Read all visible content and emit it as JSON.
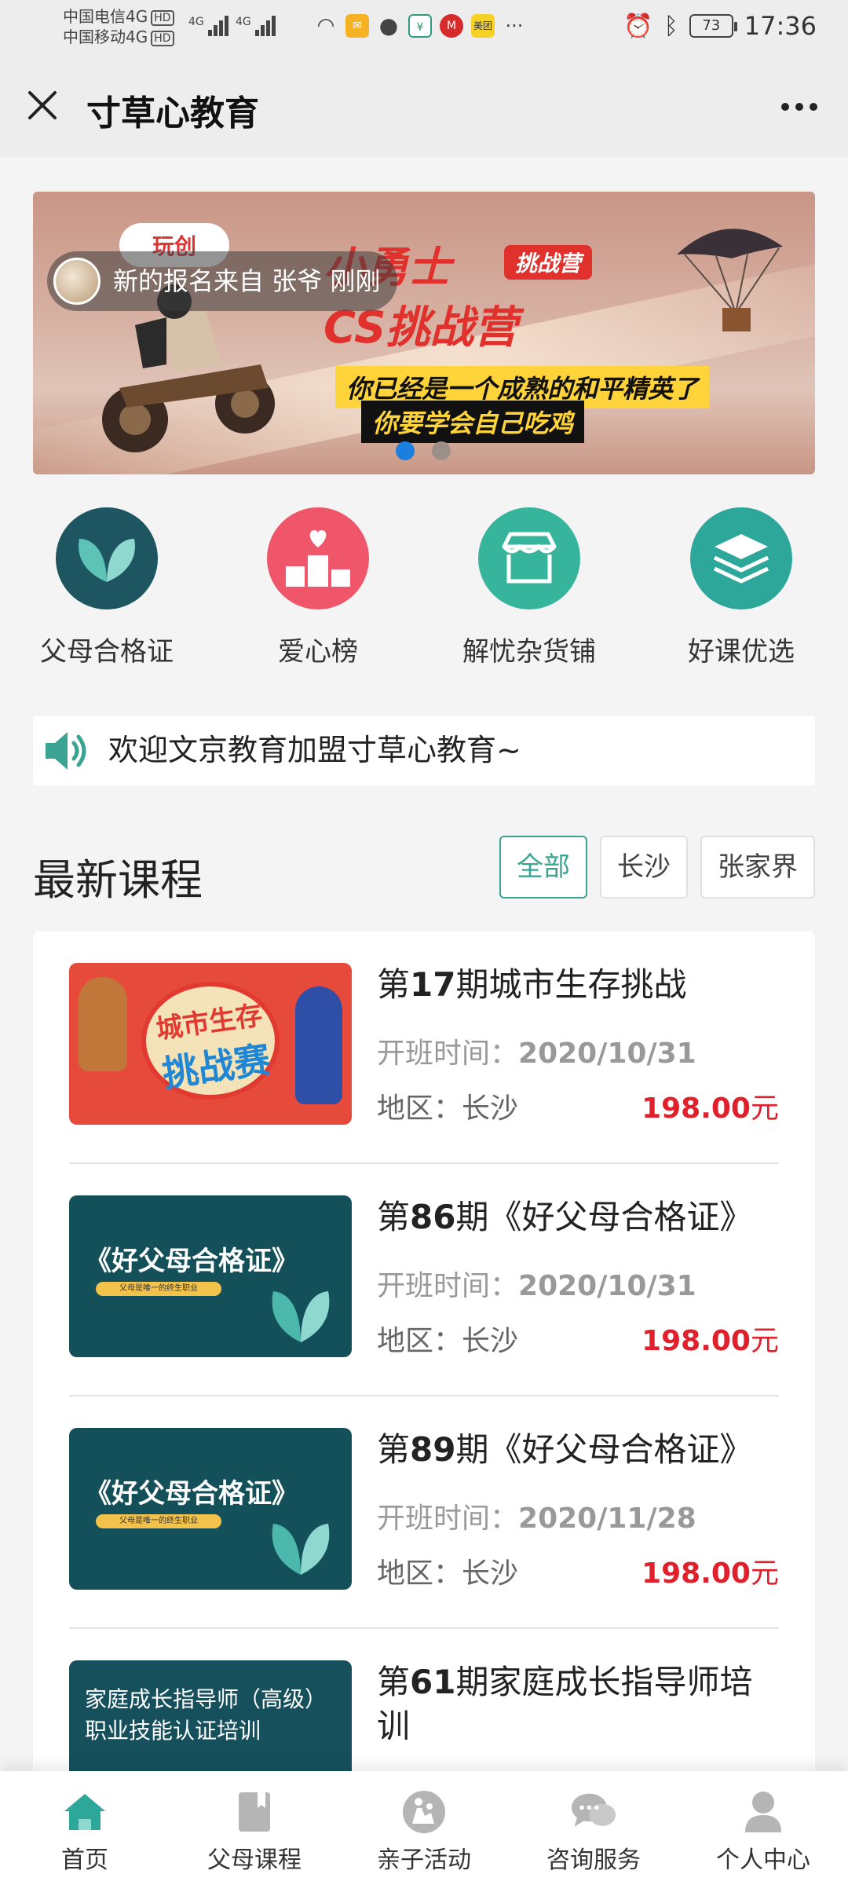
{
  "status_bar": {
    "carrier1": "中国电信4G",
    "carrier2": "中国移动4G",
    "hd": "HD",
    "net1": "4G",
    "net2": "4G",
    "app_badge": "美团",
    "more": "···",
    "battery": "73",
    "time": "17:36"
  },
  "header": {
    "title": "寸草心教育"
  },
  "banner": {
    "logo": "玩创",
    "headline1": "小勇士",
    "tag": "挑战营",
    "headline2": "CS挑战营",
    "line1": "你已经是一个成熟的和平精英了",
    "line2": "你要学会自己吃鸡",
    "notice": "新的报名来自 张爷 刚刚",
    "active_slide": 0,
    "slide_count": 2
  },
  "quick_nav": [
    {
      "label": "父母合格证",
      "icon": "heart-leaf-icon",
      "color": "#1d5560"
    },
    {
      "label": "爱心榜",
      "icon": "podium-heart-icon",
      "color": "#f0566a"
    },
    {
      "label": "解忧杂货铺",
      "icon": "shop-icon",
      "color": "#36b59c"
    },
    {
      "label": "好课优选",
      "icon": "layers-icon",
      "color": "#2ea79b"
    }
  ],
  "announcement": {
    "text": "欢迎文京教育加盟寸草心教育~"
  },
  "courses_section": {
    "title": "最新课程",
    "filters": [
      "全部",
      "长沙",
      "张家界"
    ],
    "active_filter": "全部"
  },
  "courses": [
    {
      "title_pre": "第",
      "issue": "17",
      "title_post": "期城市生存挑战",
      "time_label": "开班时间：",
      "time": "2020/10/31",
      "region_label": "地区：",
      "region": "长沙",
      "price": "198.00",
      "currency": "元",
      "thumb_text1": "城市生存",
      "thumb_text2": "挑战赛"
    },
    {
      "title_pre": "第",
      "issue": "86",
      "title_post": "期《好父母合格证》",
      "time_label": "开班时间：",
      "time": "2020/10/31",
      "region_label": "地区：",
      "region": "长沙",
      "price": "198.00",
      "currency": "元",
      "thumb_text1": "《好父母合格证》",
      "thumb_text2": "父母是唯一的终生职业"
    },
    {
      "title_pre": "第",
      "issue": "89",
      "title_post": "期《好父母合格证》",
      "time_label": "开班时间：",
      "time": "2020/11/28",
      "region_label": "地区：",
      "region": "长沙",
      "price": "198.00",
      "currency": "元",
      "thumb_text1": "《好父母合格证》",
      "thumb_text2": "父母是唯一的终生职业"
    },
    {
      "title_pre": "第",
      "issue": "61",
      "title_post": "期家庭成长指导师培训",
      "thumb_text1": "家庭成长指导师（高级）",
      "thumb_text2": "职业技能认证培训"
    }
  ],
  "tabbar": [
    {
      "label": "首页",
      "icon": "home-icon",
      "active": true
    },
    {
      "label": "父母课程",
      "icon": "book-icon",
      "active": false
    },
    {
      "label": "亲子活动",
      "icon": "family-icon",
      "active": false
    },
    {
      "label": "咨询服务",
      "icon": "chat-icon",
      "active": false
    },
    {
      "label": "个人中心",
      "icon": "user-icon",
      "active": false
    }
  ],
  "colors": {
    "accent": "#3aa392",
    "price": "#e0212b",
    "tab_active": "#2ea79b",
    "tab_inactive": "#b5b5b5"
  }
}
